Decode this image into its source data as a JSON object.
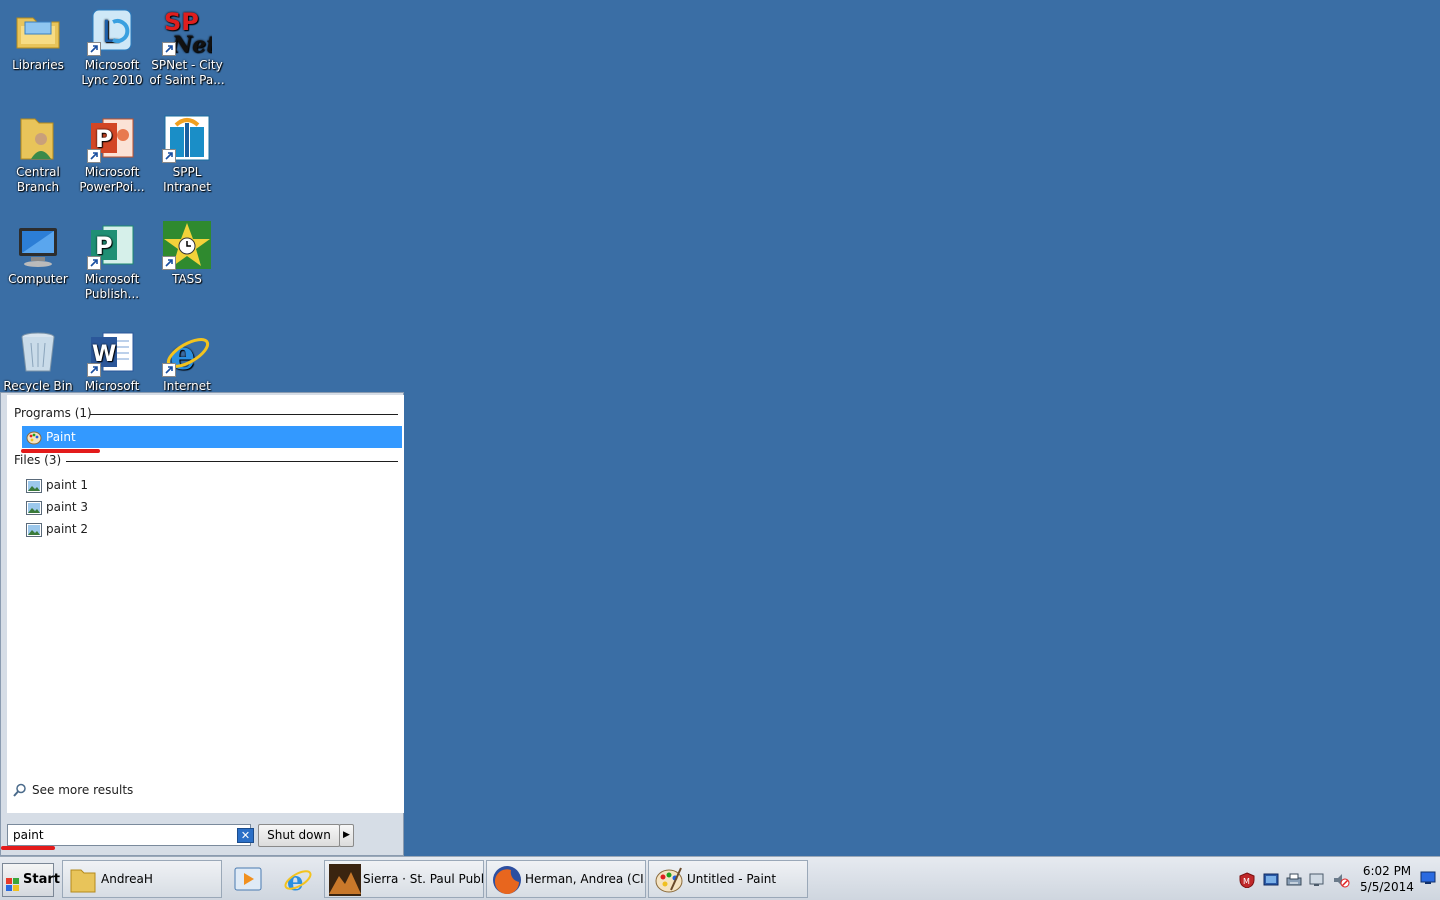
{
  "desktop": {
    "background_color": "#3a6ea5",
    "icons": [
      {
        "label": "Libraries",
        "icon": "libraries-folder-icon"
      },
      {
        "label": "Microsoft Lync 2010",
        "icon": "lync-icon"
      },
      {
        "label": "SPNet - City of Saint Pa...",
        "icon": "spnet-icon"
      },
      {
        "label": "Central Branch",
        "icon": "user-folder-icon"
      },
      {
        "label": "Microsoft PowerPoi...",
        "icon": "powerpoint-icon"
      },
      {
        "label": "SPPL Intranet",
        "icon": "sppl-intranet-icon"
      },
      {
        "label": "Computer",
        "icon": "computer-icon"
      },
      {
        "label": "Microsoft Publish...",
        "icon": "publisher-icon"
      },
      {
        "label": "TASS",
        "icon": "tass-clock-icon"
      },
      {
        "label": "Recycle Bin",
        "icon": "recycle-bin-icon"
      },
      {
        "label": "Microsoft",
        "icon": "word-icon"
      },
      {
        "label": "Internet",
        "icon": "internet-explorer-icon"
      }
    ]
  },
  "start_menu": {
    "programs_header": "Programs (1)",
    "programs": [
      {
        "label": "Paint",
        "selected": true,
        "icon": "paint-palette-icon"
      }
    ],
    "files_header": "Files (3)",
    "files": [
      {
        "label": "paint 1",
        "icon": "image-file-icon"
      },
      {
        "label": "paint 3",
        "icon": "image-file-icon"
      },
      {
        "label": "paint 2",
        "icon": "image-file-icon"
      }
    ],
    "see_more": "See more results",
    "search_value": "paint",
    "shutdown_label": "Shut down",
    "selection_color": "#3399ff",
    "annotation_color": "#e31b1b"
  },
  "taskbar": {
    "start_label": "Start",
    "buttons": [
      {
        "label": "AndreaH",
        "icon": "folder-icon"
      },
      {
        "label": "Sierra · St. Paul Publi...",
        "icon": "sierra-icon"
      },
      {
        "label": "Herman, Andrea (CI...",
        "icon": "firefox-icon"
      },
      {
        "label": "Untitled - Paint",
        "icon": "paint-palette-icon"
      }
    ],
    "quick_launch": [
      "media-player-icon",
      "internet-explorer-icon"
    ],
    "tray_icons": [
      "shield-icon",
      "network-icon",
      "printer-icon",
      "display-icon",
      "volume-muted-icon"
    ],
    "clock_time": "6:02 PM",
    "clock_date": "5/5/2014"
  }
}
